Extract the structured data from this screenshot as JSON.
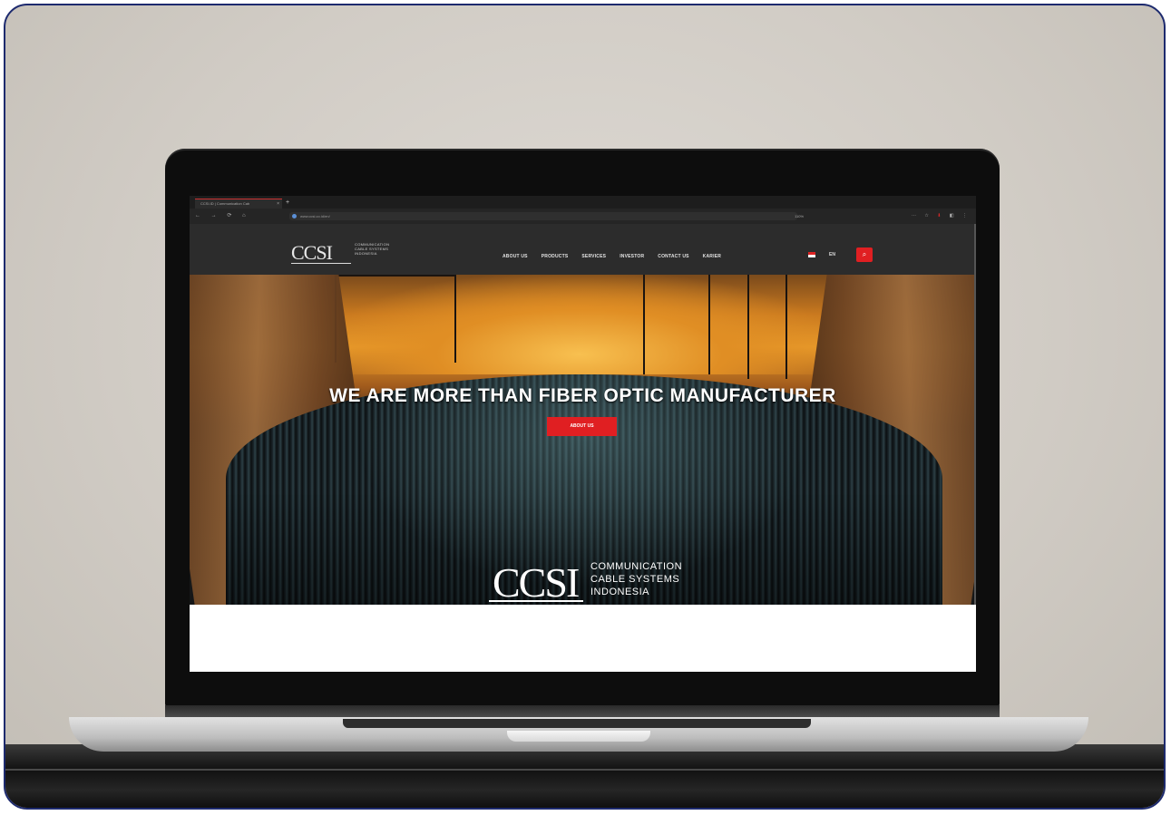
{
  "browser": {
    "tab_title": "CCSI.ID | Communication Cab",
    "tab_close": "×",
    "new_tab": "+",
    "nav": "← → ⟳ ⌂",
    "url": "www.ccsi.co.id/en/",
    "zoom": "110%",
    "extensions": [
      "⋯",
      "☆",
      "⬇",
      "◧",
      "⋮"
    ]
  },
  "site": {
    "logo": "CCSI",
    "logo_tagline": [
      "COMMUNICATION",
      "CABLE SYSTEMS",
      "INDONESIA"
    ],
    "menu": [
      "ABOUT US",
      "PRODUCTS",
      "SERVICES",
      "INVESTOR",
      "CONTACT US",
      "KARIER"
    ],
    "lang": "EN",
    "search_icon": "⌕"
  },
  "hero": {
    "title": "WE ARE MORE THAN FIBER OPTIC MANUFACTURER",
    "button": "ABOUT US",
    "logo": "CCSI",
    "logo_tagline": [
      "COMMUNICATION",
      "CABLE SYSTEMS",
      "INDONESIA"
    ]
  },
  "colors": {
    "accent": "#e01f22",
    "frame": "#1d2a6e"
  }
}
